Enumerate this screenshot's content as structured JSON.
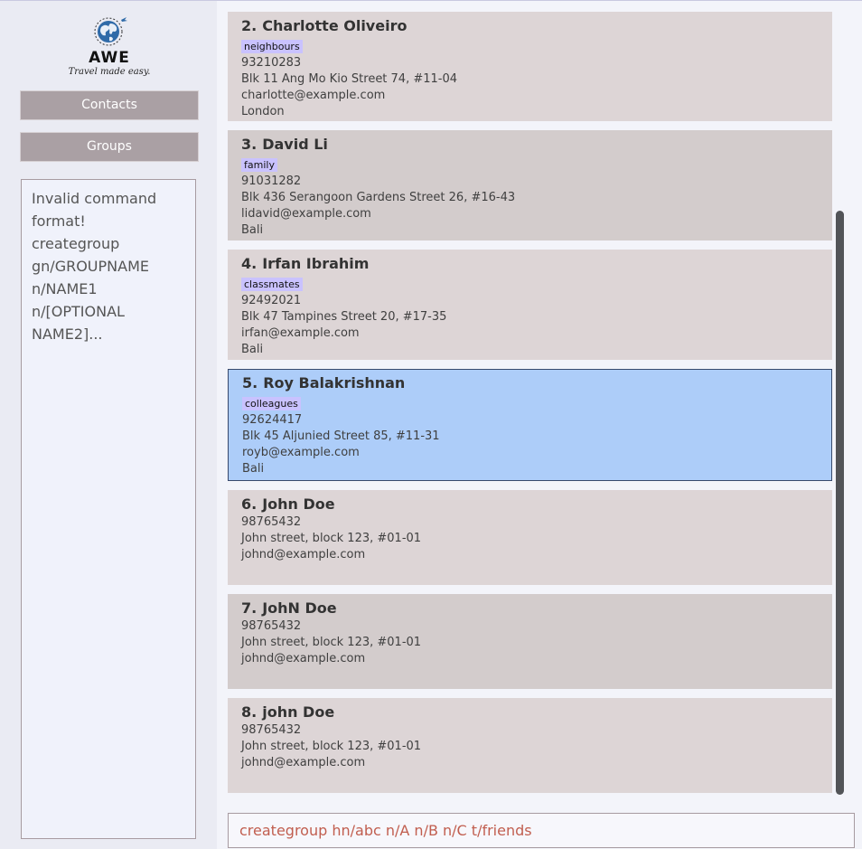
{
  "app": {
    "logo_text": "AWE",
    "logo_tagline": "Travel made easy."
  },
  "nav": {
    "contacts_label": "Contacts",
    "groups_label": "Groups"
  },
  "result_display": {
    "lines": [
      "Invalid command",
      "format!",
      "creategroup",
      "gn/GROUPNAME",
      "n/NAME1",
      "n/[OPTIONAL",
      "NAME2]..."
    ]
  },
  "contacts": [
    {
      "index": "2.",
      "name": "Charlotte Oliveiro",
      "tag": "neighbours",
      "phone": "93210283",
      "address": "Blk 11 Ang Mo Kio Street 74, #11-04",
      "email": "charlotte@example.com",
      "location": "London"
    },
    {
      "index": "3.",
      "name": "David Li",
      "tag": "family",
      "phone": "91031282",
      "address": "Blk 436 Serangoon Gardens Street 26, #16-43",
      "email": "lidavid@example.com",
      "location": "Bali"
    },
    {
      "index": "4.",
      "name": "Irfan Ibrahim",
      "tag": "classmates",
      "phone": "92492021",
      "address": "Blk 47 Tampines Street 20, #17-35",
      "email": "irfan@example.com",
      "location": "Bali"
    },
    {
      "index": "5.",
      "name": "Roy Balakrishnan",
      "tag": "colleagues",
      "phone": "92624417",
      "address": "Blk 45 Aljunied Street 85, #11-31",
      "email": "royb@example.com",
      "location": "Bali",
      "selected": true
    },
    {
      "index": "6.",
      "name": "John Doe",
      "tag": "",
      "phone": "98765432",
      "address": "John street, block 123, #01-01",
      "email": "johnd@example.com",
      "location": ""
    },
    {
      "index": "7.",
      "name": "JohN Doe",
      "tag": "",
      "phone": "98765432",
      "address": "John street, block 123, #01-01",
      "email": "johnd@example.com",
      "location": ""
    },
    {
      "index": "8.",
      "name": "john Doe",
      "tag": "",
      "phone": "98765432",
      "address": "John street, block 123, #01-01",
      "email": "johnd@example.com",
      "location": ""
    }
  ],
  "command_box": {
    "value": "creategroup hn/abc n/A n/B n/C t/friends"
  },
  "colors": {
    "selected_card": "#adcdf9",
    "tag_background": "#c9c2ff",
    "command_text": "#c15e4f",
    "nav_button": "#aaa0a4"
  }
}
